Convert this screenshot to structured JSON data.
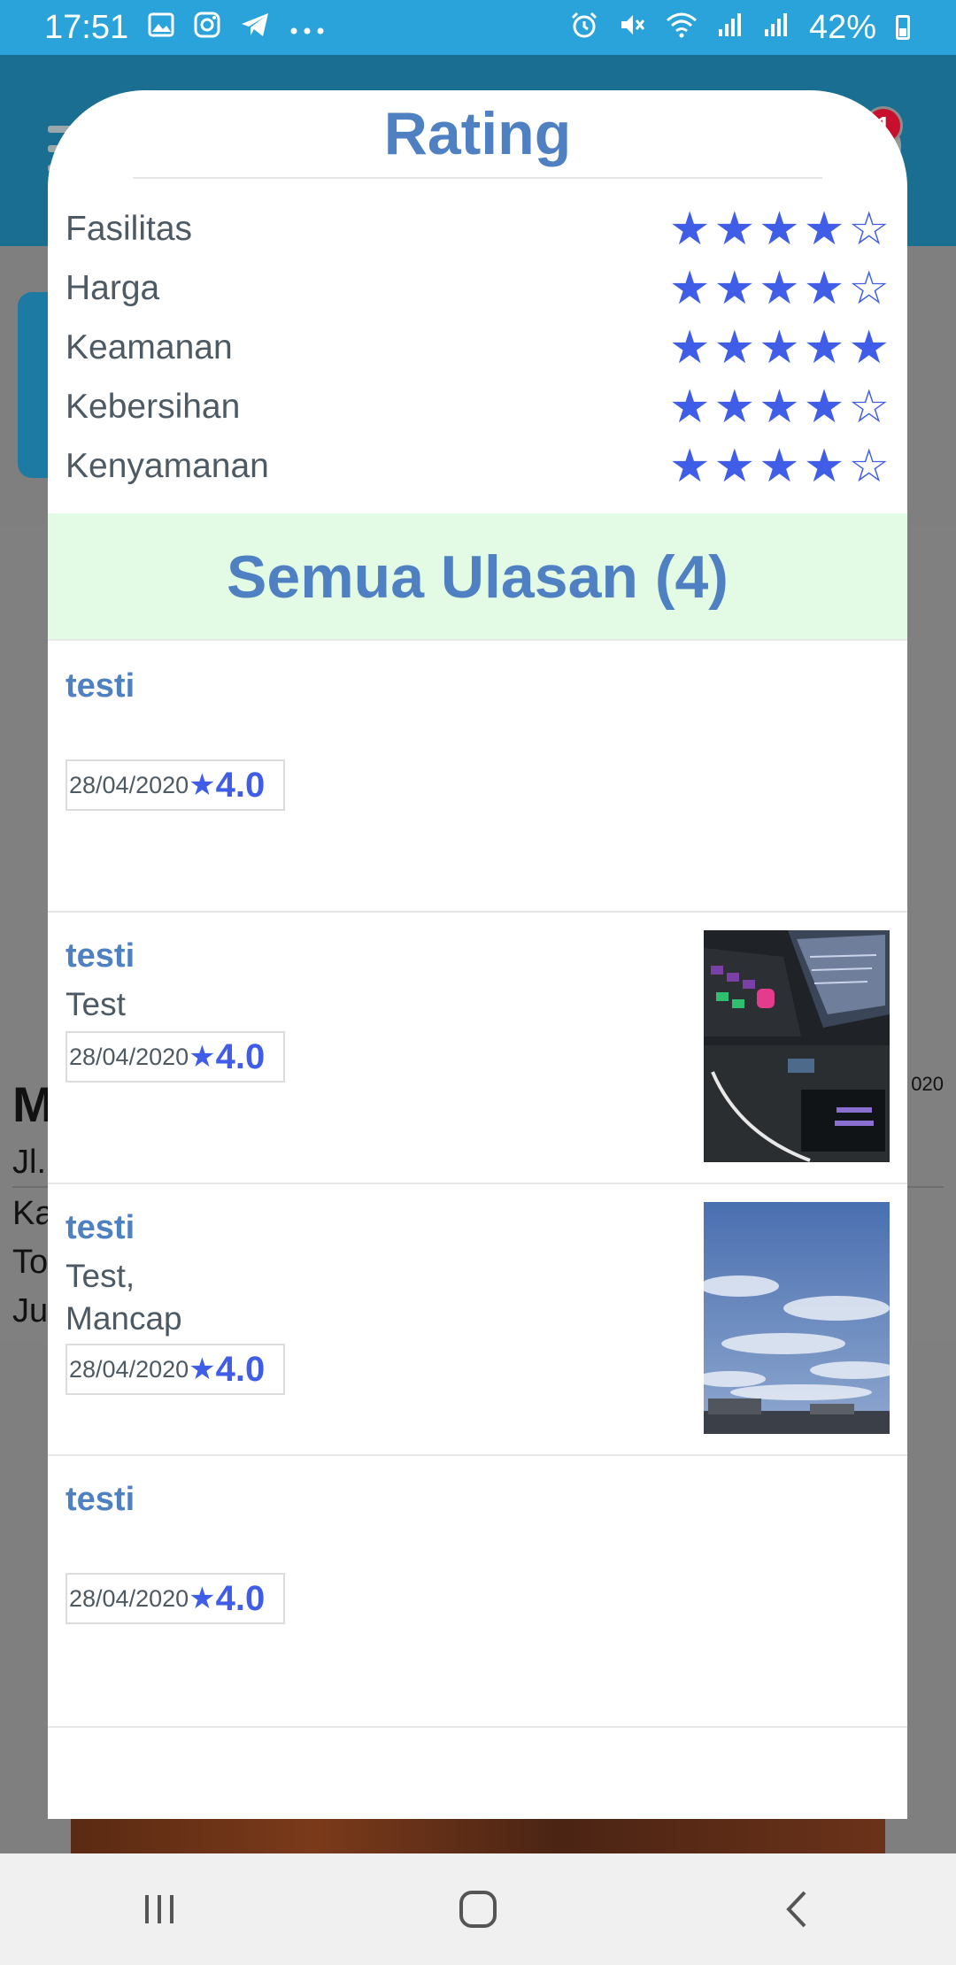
{
  "status_bar": {
    "time": "17:51",
    "battery": "42%",
    "left_icons": [
      "gallery-icon",
      "instagram-icon",
      "telegram-icon",
      "more-icon"
    ],
    "right_icons": [
      "alarm-icon",
      "mute-icon",
      "wifi-icon",
      "signal-icon",
      "signal-icon",
      "battery-icon"
    ]
  },
  "background": {
    "notification_count": "1",
    "text_lines": [
      "M",
      "Jl.",
      "Ka",
      "To",
      "Ju"
    ],
    "date_fragment": "020"
  },
  "modal": {
    "title": "Rating",
    "ratings": [
      {
        "label": "Fasilitas",
        "stars": 4
      },
      {
        "label": "Harga",
        "stars": 4
      },
      {
        "label": "Keamanan",
        "stars": 5
      },
      {
        "label": "Kebersihan",
        "stars": 4
      },
      {
        "label": "Kenyamanan",
        "stars": 4
      }
    ],
    "reviews_header": "Semua Ulasan (4)",
    "reviews": [
      {
        "name": "testi",
        "text": "",
        "date": "28/04/2020",
        "score": "4.0",
        "photo": ""
      },
      {
        "name": "testi",
        "text": "Test",
        "date": "28/04/2020",
        "score": "4.0",
        "photo": "keyboard-photo"
      },
      {
        "name": "testi",
        "text": "Test,\nMancap",
        "date": "28/04/2020",
        "score": "4.0",
        "photo": "sky-photo"
      },
      {
        "name": "testi",
        "text": "",
        "date": "28/04/2020",
        "score": "4.0",
        "photo": ""
      }
    ]
  },
  "colors": {
    "status_bar": "#29a3d9",
    "accent_text": "#4e80c2",
    "star": "#3f5de6",
    "reviews_header_bg": "#e3fbe4"
  }
}
